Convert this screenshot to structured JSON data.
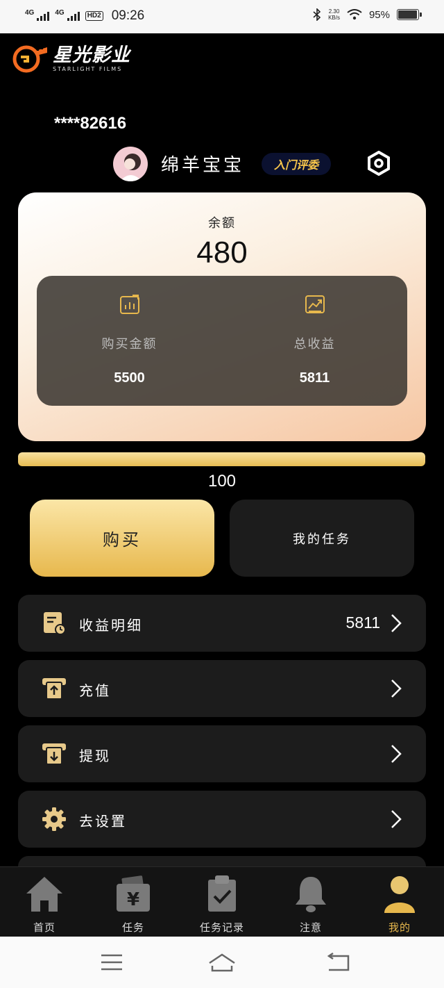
{
  "status_bar": {
    "net1": "4G",
    "net2": "4G",
    "hd": "HD2",
    "time": "09:26",
    "speed_value": "2.30",
    "speed_unit": "KB/s",
    "battery": "95%",
    "battery_fraction": 0.95
  },
  "brand": {
    "name": "星光影业",
    "subtitle": "STARLIGHT FILMS"
  },
  "user": {
    "account": "****82616",
    "nickname": "绵羊宝宝",
    "level": "入门评委"
  },
  "balance": {
    "label": "余额",
    "value": "480",
    "purchase_label": "购买金额",
    "purchase_value": "5500",
    "earnings_label": "总收益",
    "earnings_value": "5811"
  },
  "progress": {
    "value": "100",
    "fraction": 1.0
  },
  "actions": {
    "buy": "购买",
    "my_tasks": "我的任务"
  },
  "menu": [
    {
      "label": "收益明细",
      "value": "5811",
      "icon": "earnings-detail-icon"
    },
    {
      "label": "充值",
      "value": "",
      "icon": "recharge-icon"
    },
    {
      "label": "提现",
      "value": "",
      "icon": "withdraw-icon"
    },
    {
      "label": "去设置",
      "value": "",
      "icon": "gear-icon"
    }
  ],
  "nav": [
    {
      "label": "首页",
      "icon": "home-icon"
    },
    {
      "label": "任务",
      "icon": "task-icon"
    },
    {
      "label": "任务记录",
      "icon": "clipboard-icon"
    },
    {
      "label": "注意",
      "icon": "bell-icon"
    },
    {
      "label": "我的",
      "icon": "user-icon",
      "active": true
    }
  ],
  "colors": {
    "gold": "#e7b84d",
    "card_bg": "#1c1c1c",
    "badge_bg": "#0b1130"
  }
}
